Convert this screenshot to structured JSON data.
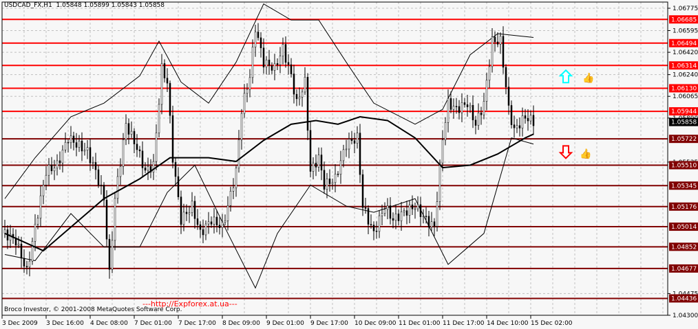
{
  "header": {
    "symbol": "USDCAD_FX,H1",
    "ohlc": "1.05848 1.05899 1.05843 1.05858"
  },
  "footer": {
    "copyright": "Broco Investor, © 2001-2008 MetaQuotes Software Corp.",
    "watermark": "---http://Expforex.at.ua---"
  },
  "colors": {
    "resistance": "#ff0000",
    "support": "#800000",
    "current": "#000000",
    "up_arrow": "#00ffff",
    "down_arrow": "#ff0000",
    "thumb": "#00e5ff"
  },
  "signals": [
    {
      "icon": "up-arrow-icon",
      "price": 1.0622
    },
    {
      "icon": "down-arrow-icon",
      "price": 1.0561
    }
  ],
  "chart_data": {
    "type": "line",
    "title": "USDCAD_FX,H1",
    "ylim": [
      1.043,
      1.0683
    ],
    "y_ticks": [
      "1.06775",
      "1.06595",
      "1.06420",
      "1.06240",
      "1.06065",
      "1.05890",
      "1.05535",
      "1.04475",
      "1.04300"
    ],
    "x_ticks": [
      {
        "bar": 0,
        "label": "3 Dec 2009"
      },
      {
        "bar": 16,
        "label": "3 Dec 16:00"
      },
      {
        "bar": 32,
        "label": "4 Dec 08:00"
      },
      {
        "bar": 48,
        "label": "7 Dec 01:00"
      },
      {
        "bar": 64,
        "label": "7 Dec 17:00"
      },
      {
        "bar": 80,
        "label": "8 Dec 09:00"
      },
      {
        "bar": 96,
        "label": "9 Dec 01:00"
      },
      {
        "bar": 112,
        "label": "9 Dec 17:00"
      },
      {
        "bar": 128,
        "label": "10 Dec 09:00"
      },
      {
        "bar": 144,
        "label": "11 Dec 01:00"
      },
      {
        "bar": 160,
        "label": "11 Dec 17:00"
      },
      {
        "bar": 176,
        "label": "14 Dec 10:00"
      },
      {
        "bar": 192,
        "label": "15 Dec 02:00"
      }
    ],
    "current_price": "1.05858",
    "levels": [
      {
        "price": "1.06685",
        "type": "resistance"
      },
      {
        "price": "1.06494",
        "type": "resistance"
      },
      {
        "price": "1.06314",
        "type": "resistance"
      },
      {
        "price": "1.06130",
        "type": "resistance"
      },
      {
        "price": "1.05944",
        "type": "resistance"
      },
      {
        "price": "1.05722",
        "type": "support"
      },
      {
        "price": "1.05510",
        "type": "support"
      },
      {
        "price": "1.05345",
        "type": "support"
      },
      {
        "price": "1.05176",
        "type": "support"
      },
      {
        "price": "1.05014",
        "type": "support"
      },
      {
        "price": "1.04852",
        "type": "support"
      },
      {
        "price": "1.04677",
        "type": "support"
      },
      {
        "price": "1.04436",
        "type": "support"
      }
    ],
    "close_path": [
      [
        1,
        1.0496
      ],
      [
        5,
        1.049
      ],
      [
        9,
        1.0465
      ],
      [
        12,
        1.0501
      ],
      [
        16,
        1.0546
      ],
      [
        20,
        1.0551
      ],
      [
        24,
        1.0573
      ],
      [
        27,
        1.0568
      ],
      [
        31,
        1.0562
      ],
      [
        34,
        1.0546
      ],
      [
        37,
        1.0524
      ],
      [
        39,
        1.0463
      ],
      [
        41,
        1.0524
      ],
      [
        45,
        1.0584
      ],
      [
        49,
        1.0565
      ],
      [
        52,
        1.0546
      ],
      [
        55,
        1.0551
      ],
      [
        58,
        1.0629
      ],
      [
        60,
        1.0618
      ],
      [
        62,
        1.0557
      ],
      [
        65,
        1.0507
      ],
      [
        69,
        1.0518
      ],
      [
        72,
        1.0496
      ],
      [
        76,
        1.0507
      ],
      [
        80,
        1.0501
      ],
      [
        82,
        1.0518
      ],
      [
        85,
        1.0546
      ],
      [
        87,
        1.0596
      ],
      [
        90,
        1.0623
      ],
      [
        92,
        1.0662
      ],
      [
        95,
        1.0634
      ],
      [
        99,
        1.0629
      ],
      [
        102,
        1.0645
      ],
      [
        105,
        1.0623
      ],
      [
        107,
        1.0601
      ],
      [
        110,
        1.0618
      ],
      [
        112,
        1.0546
      ],
      [
        115,
        1.0557
      ],
      [
        117,
        1.0535
      ],
      [
        121,
        1.054
      ],
      [
        125,
        1.0568
      ],
      [
        129,
        1.0573
      ],
      [
        131,
        1.0518
      ],
      [
        135,
        1.0496
      ],
      [
        139,
        1.0518
      ],
      [
        142,
        1.0507
      ],
      [
        146,
        1.0513
      ],
      [
        150,
        1.0518
      ],
      [
        154,
        1.0507
      ],
      [
        157,
        1.0501
      ],
      [
        160,
        1.0573
      ],
      [
        162,
        1.0601
      ],
      [
        165,
        1.0596
      ],
      [
        169,
        1.0601
      ],
      [
        172,
        1.0584
      ],
      [
        175,
        1.0601
      ],
      [
        178,
        1.0651
      ],
      [
        181,
        1.0651
      ],
      [
        184,
        1.0596
      ],
      [
        186,
        1.0579
      ],
      [
        190,
        1.059
      ],
      [
        193,
        1.0586
      ]
    ],
    "moving_average": [
      [
        1,
        1.0496
      ],
      [
        15,
        1.0482
      ],
      [
        37,
        1.0524
      ],
      [
        50,
        1.054
      ],
      [
        61,
        1.0557
      ],
      [
        75,
        1.0557
      ],
      [
        85,
        1.0554
      ],
      [
        95,
        1.0571
      ],
      [
        105,
        1.0584
      ],
      [
        114,
        1.0587
      ],
      [
        122,
        1.0584
      ],
      [
        130,
        1.059
      ],
      [
        140,
        1.0587
      ],
      [
        150,
        1.0573
      ],
      [
        160,
        1.0549
      ],
      [
        170,
        1.0551
      ],
      [
        180,
        1.056
      ],
      [
        190,
        1.0573
      ],
      [
        193,
        1.0576
      ]
    ],
    "upper_band": [
      [
        1,
        1.0524
      ],
      [
        12,
        1.0557
      ],
      [
        25,
        1.059
      ],
      [
        37,
        1.0601
      ],
      [
        50,
        1.0623
      ],
      [
        57,
        1.0651
      ],
      [
        65,
        1.0618
      ],
      [
        75,
        1.0601
      ],
      [
        85,
        1.0634
      ],
      [
        95,
        1.0681
      ],
      [
        105,
        1.0668
      ],
      [
        115,
        1.0668
      ],
      [
        125,
        1.0634
      ],
      [
        135,
        1.0601
      ],
      [
        150,
        1.0584
      ],
      [
        160,
        1.0596
      ],
      [
        170,
        1.064
      ],
      [
        180,
        1.0657
      ],
      [
        193,
        1.0654
      ]
    ],
    "lower_band": [
      [
        1,
        1.0479
      ],
      [
        12,
        1.0474
      ],
      [
        25,
        1.0512
      ],
      [
        37,
        1.0485
      ],
      [
        50,
        1.0485
      ],
      [
        60,
        1.0529
      ],
      [
        70,
        1.0551
      ],
      [
        82,
        1.0496
      ],
      [
        92,
        1.0452
      ],
      [
        100,
        1.0496
      ],
      [
        112,
        1.0535
      ],
      [
        125,
        1.0518
      ],
      [
        135,
        1.0513
      ],
      [
        150,
        1.0524
      ],
      [
        162,
        1.0471
      ],
      [
        175,
        1.0496
      ],
      [
        185,
        1.0573
      ],
      [
        193,
        1.0568
      ]
    ]
  }
}
